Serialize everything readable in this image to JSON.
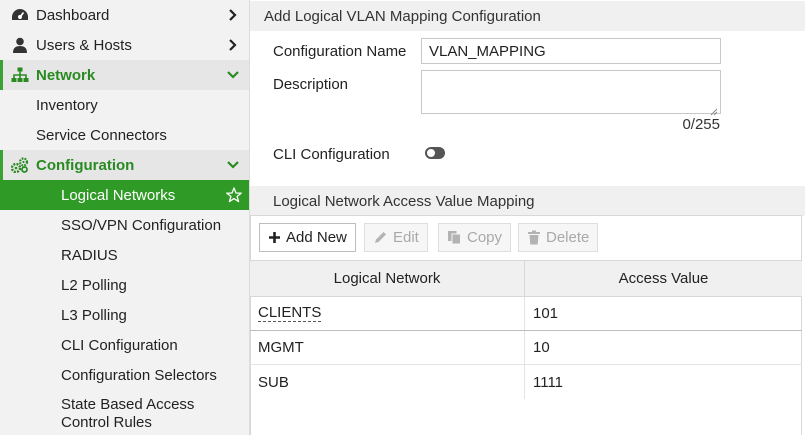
{
  "sidebar": {
    "dashboard": "Dashboard",
    "users_hosts": "Users & Hosts",
    "network": "Network",
    "inventory": "Inventory",
    "service_connectors": "Service Connectors",
    "configuration": "Configuration",
    "logical_networks": "Logical Networks",
    "sso_vpn": "SSO/VPN Configuration",
    "radius": "RADIUS",
    "l2_polling": "L2 Polling",
    "l3_polling": "L3 Polling",
    "cli_configuration": "CLI Configuration",
    "configuration_selectors": "Configuration Selectors",
    "state_based_1": "State Based Access",
    "state_based_2": "Control Rules"
  },
  "form": {
    "title": "Add Logical VLAN Mapping Configuration",
    "config_name_label": "Configuration Name",
    "config_name_value": "VLAN_MAPPING",
    "description_label": "Description",
    "description_value": "",
    "char_counter": "0/255",
    "cli_config_label": "CLI Configuration",
    "cli_config_enabled": false
  },
  "mapping": {
    "title": "Logical Network Access Value Mapping",
    "toolbar": {
      "add_new": "Add New",
      "edit": "Edit",
      "copy": "Copy",
      "delete": "Delete"
    },
    "columns": [
      "Logical Network",
      "Access Value"
    ],
    "rows": [
      {
        "network": "CLIENTS",
        "value": "101"
      },
      {
        "network": "MGMT",
        "value": "10"
      },
      {
        "network": "SUB",
        "value": "1111"
      }
    ]
  },
  "colors": {
    "accent_green": "#2f9a25",
    "green_text": "#2a8a22"
  },
  "icons": {
    "dashboard": "dashboard-gauge-icon",
    "users": "user-icon",
    "network": "sitemap-icon",
    "configuration": "cogs-icon",
    "favorite": "star-outline-icon",
    "add": "plus-icon",
    "edit": "pencil-icon",
    "copy": "copy-icon",
    "delete": "trash-icon"
  }
}
